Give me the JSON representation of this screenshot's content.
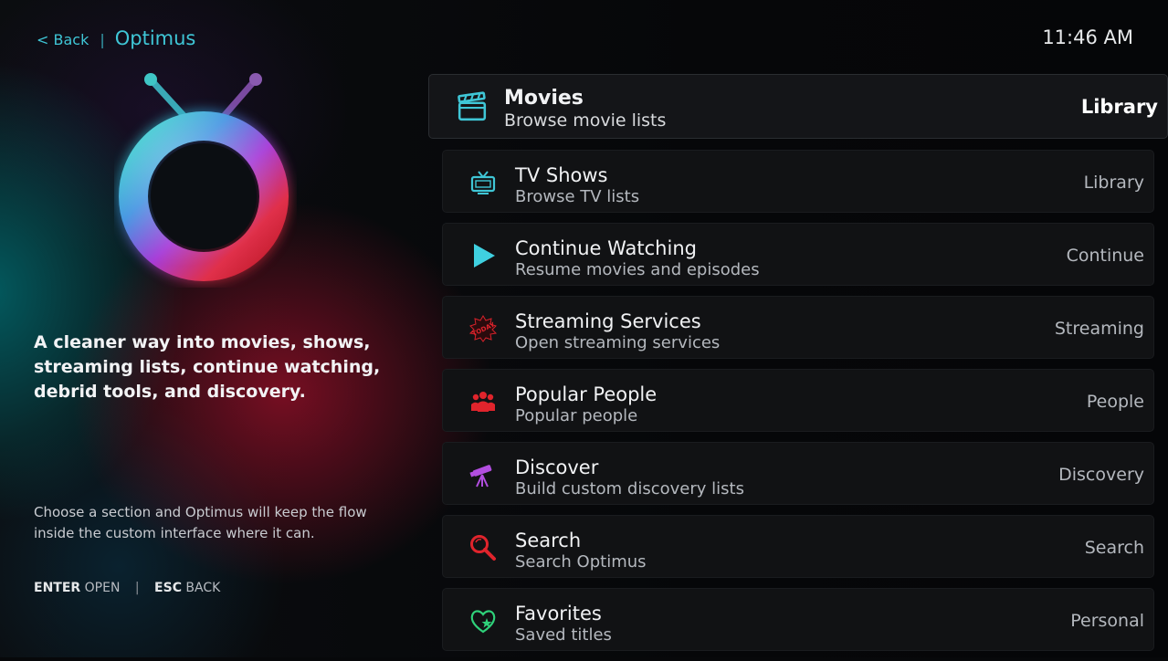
{
  "header": {
    "back_label": "< Back",
    "separator": "|",
    "app_title": "Optimus",
    "clock": "11:46 AM"
  },
  "left": {
    "tagline": "A cleaner way into movies, shows, streaming lists, continue watching, debrid tools, and discovery.",
    "hint": "Choose a section and Optimus will keep the flow inside the custom interface where it can.",
    "keys": {
      "enter_key": "ENTER",
      "enter_action": "OPEN",
      "separator": "|",
      "esc_key": "ESC",
      "esc_action": "BACK"
    }
  },
  "menu": {
    "items": [
      {
        "title": "Movies",
        "subtitle": "Browse movie lists",
        "tag": "Library",
        "icon": "clapperboard-icon",
        "icon_color": "#3fc6d6",
        "active": true
      },
      {
        "title": "TV Shows",
        "subtitle": "Browse TV lists",
        "tag": "Library",
        "icon": "tv-icon",
        "icon_color": "#3fc6d6"
      },
      {
        "title": "Continue Watching",
        "subtitle": "Resume movies and episodes",
        "tag": "Continue",
        "icon": "play-icon",
        "icon_color": "#3fd0e0"
      },
      {
        "title": "Streaming Services",
        "subtitle": "Open streaming services",
        "tag": "Streaming",
        "icon": "today-badge-icon",
        "icon_color": "#d6222b",
        "icon_text": "TODAY"
      },
      {
        "title": "Popular People",
        "subtitle": "Popular people",
        "tag": "People",
        "icon": "people-icon",
        "icon_color": "#e0242c"
      },
      {
        "title": "Discover",
        "subtitle": "Build custom discovery lists",
        "tag": "Discovery",
        "icon": "telescope-icon",
        "icon_color": "#b24ee0"
      },
      {
        "title": "Search",
        "subtitle": "Search Optimus",
        "tag": "Search",
        "icon": "search-icon",
        "icon_color": "#e0242c"
      },
      {
        "title": "Favorites",
        "subtitle": "Saved titles",
        "tag": "Personal",
        "icon": "heart-star-icon",
        "icon_color": "#2fd17a"
      }
    ]
  },
  "colors": {
    "accent": "#3fc6d6",
    "background": "#07080a",
    "row_background": "#111214"
  }
}
